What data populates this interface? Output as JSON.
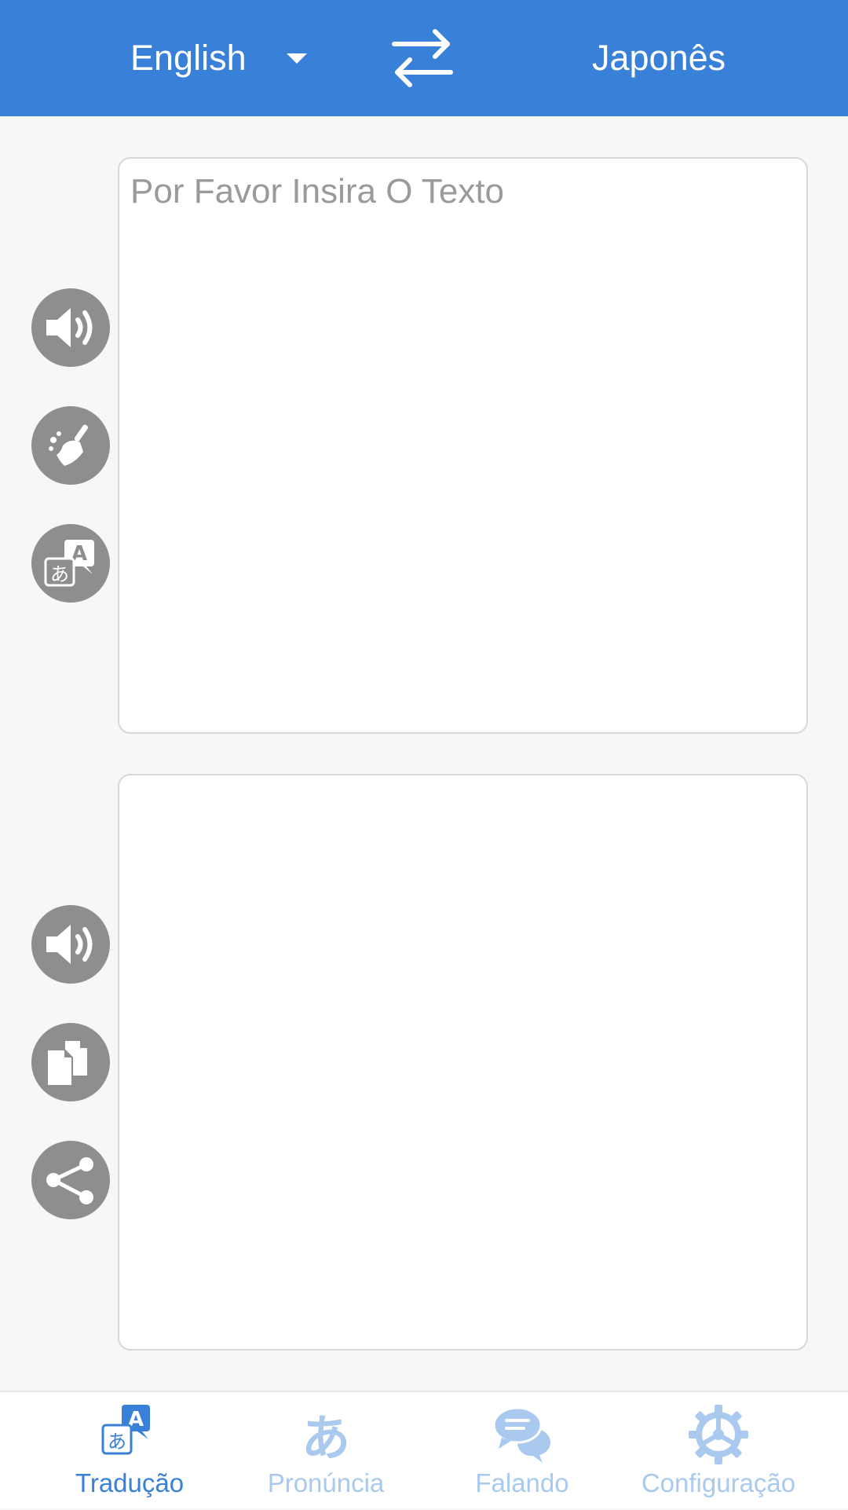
{
  "header": {
    "source_language": "English",
    "target_language": "Japonês",
    "swap_icon": "swap-arrows-icon",
    "dropdown_icon": "caret-down-icon"
  },
  "input_panel": {
    "placeholder": "Por Favor Insira O Texto",
    "value": "",
    "actions": [
      {
        "name": "speaker-icon"
      },
      {
        "name": "broom-icon"
      },
      {
        "name": "translate-icon"
      }
    ]
  },
  "output_panel": {
    "value": "",
    "actions": [
      {
        "name": "speaker-icon"
      },
      {
        "name": "copy-icon"
      },
      {
        "name": "share-icon"
      }
    ]
  },
  "bottom_nav": {
    "items": [
      {
        "label": "Tradução",
        "icon": "translate-icon",
        "active": true
      },
      {
        "label": "Pronúncia",
        "icon": "hiragana-a-icon",
        "active": false
      },
      {
        "label": "Falando",
        "icon": "chat-bubbles-icon",
        "active": false
      },
      {
        "label": "Configuração",
        "icon": "gear-icon",
        "active": false
      }
    ]
  },
  "colors": {
    "primary": "#3880d8",
    "primary_light": "#a9c9ef",
    "button_gray": "#8e8e8e",
    "background": "#f7f7f7"
  }
}
